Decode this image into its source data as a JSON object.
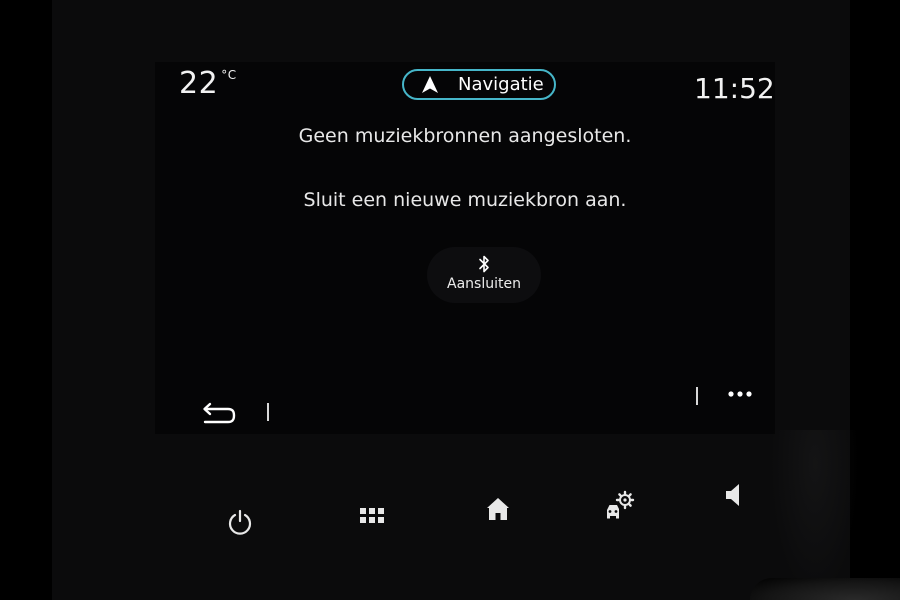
{
  "status_bar": {
    "temperature_value": "22",
    "temperature_unit": "°C",
    "clock": "11:52",
    "navigation_label": "Navigatie"
  },
  "main": {
    "message_line1": "Geen muziekbronnen aangesloten.",
    "message_line2": "Sluit een nieuwe muziekbron aan.",
    "connect_button_label": "Aansluiten",
    "connect_button_icon": "bluetooth-icon"
  },
  "action_bar": {
    "back_icon": "back-icon",
    "more_icon": "more-options-icon"
  },
  "dock": {
    "items": [
      {
        "icon": "power-icon"
      },
      {
        "icon": "apps-grid-icon"
      },
      {
        "icon": "home-icon"
      },
      {
        "icon": "vehicle-settings-icon"
      },
      {
        "icon": "volume-icon"
      }
    ]
  },
  "colors": {
    "accent": "#46b6c9",
    "background": "#050506",
    "text": "#ffffff"
  }
}
